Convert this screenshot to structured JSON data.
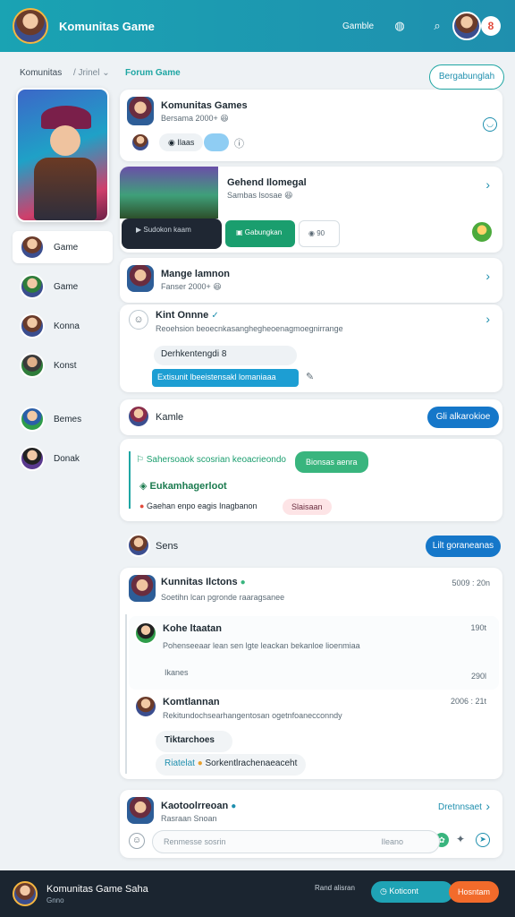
{
  "topbar": {
    "title": "Komunitas Game",
    "link": "Gamble",
    "icons": [
      "globe-icon",
      "search-icon"
    ],
    "badge": "8"
  },
  "subbar": {
    "crumb": "Komunitas",
    "crumb_sep": "/ Jrinel ⌄",
    "active_tab": "Forum Game",
    "cta": "Bergabunglah"
  },
  "sidebar": {
    "items": [
      {
        "label": "Game",
        "active": true
      },
      {
        "label": "Game"
      },
      {
        "label": "Konna"
      },
      {
        "label": "Konst"
      },
      {
        "label": "Bemes"
      },
      {
        "label": "Donak"
      }
    ]
  },
  "feed": {
    "card1": {
      "title": "Komunitas Games",
      "sub": "Bersama 2000+ 😆",
      "pill_a": "Ilaas",
      "pill_b": ""
    },
    "card2": {
      "title": "Gehend Ilomegal",
      "sub": "Sambas lsosae 😆",
      "btn_dark": "Sudokon kaam",
      "btn_green": "Gabungkan",
      "btn_light": "90"
    },
    "card3": {
      "title": "Mange lamnon",
      "sub": "Fanser 2000+ 😆"
    },
    "card4": {
      "name": "Kint Onnne",
      "text": "Reoehsion beoecnkasanghegheoenagmoegnirrange",
      "sub": "Derhkentengdi 8",
      "banner": "Extisunit lbeeistensakl lomaniaaa"
    },
    "row1": {
      "name": "Kamle",
      "btn": "Gli alkarokioe"
    },
    "card5": {
      "line1": "Sahersoaok scosrian keoacrieondo",
      "btn1": "Bionsas aenra",
      "line2": "Eukamhagerloot",
      "line3": "Gaehan enpo eagis Inagbanon",
      "chip": "Slaisaan"
    },
    "row2": {
      "name": "Sens",
      "btn": "Lilt goraneanas"
    },
    "card6": {
      "title": "Kunnitas Ilctons",
      "time": "5009 : 20n",
      "sub": "Soetihn lcan pgronde raaragsanee",
      "reply1": {
        "name": "Kohe ltaatan",
        "time": "190t",
        "text": "Pohenseeaar lean sen lgte leackan bekanloe lioenmiaa",
        "foot": "Ikanes",
        "foot_time": "290l"
      },
      "reply2": {
        "name": "Komtlannan",
        "time": "2006 : 21t",
        "text": "Rekitundochsearhangentosan ogetnfoanecconndy",
        "foot": "Tiktarchoes",
        "foot_b": "Riatelat",
        "foot_c": "Sorkentlrachenaeaceht"
      }
    },
    "composer": {
      "title": "Kaotoolrreoan",
      "sub": "Rasraan Snoan",
      "link": "Dretnnsaet",
      "placeholder": "Renmesse sosrin",
      "right": "Ileano"
    }
  },
  "bottombar": {
    "title": "Komunitas Game Saha",
    "sub": "Gnno",
    "status": "Rand alisran",
    "btn_teal": "Koticont",
    "btn_orange": "Hosntam"
  }
}
